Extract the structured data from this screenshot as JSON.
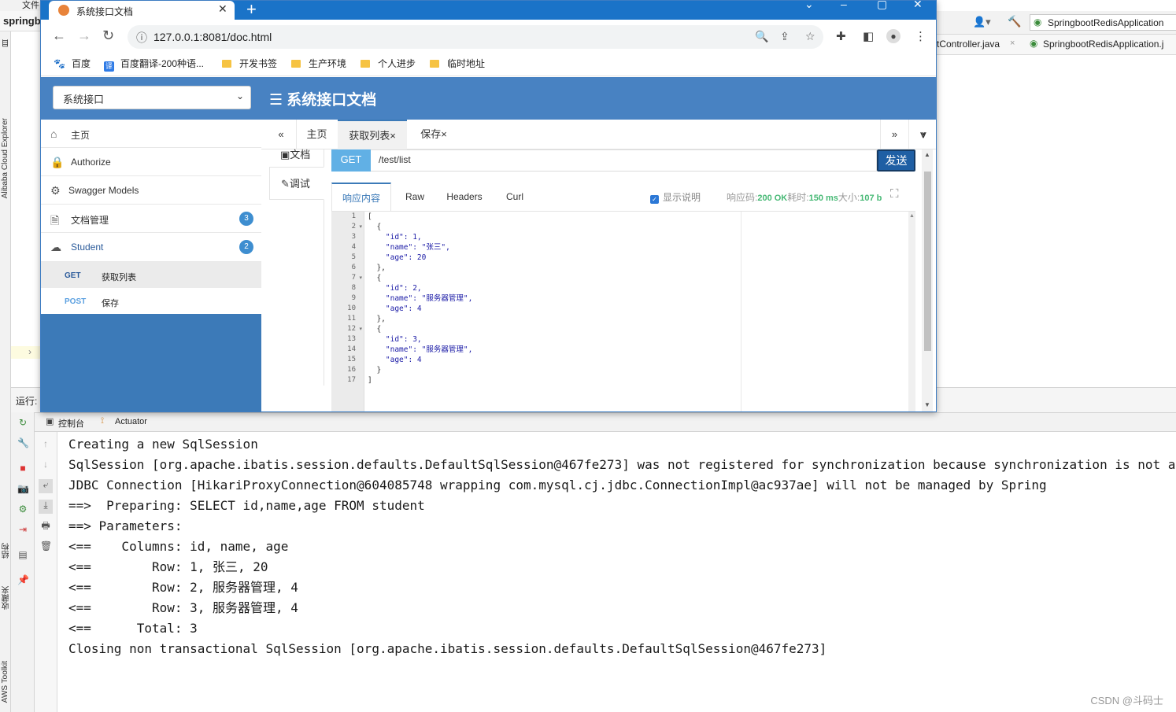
{
  "ide": {
    "left_strip": {
      "files_label": "目",
      "alibaba_label": "Alibaba Cloud Explorer",
      "structure_label": "结构",
      "favorites_label": "收藏夹",
      "aws_label": "AWS Toolkit"
    },
    "top_left_label": "springb",
    "top_left_label2": "文件",
    "right_toolbar": {
      "run_config": "SpringbootRedisApplication"
    },
    "right_tabs": [
      "tController.java",
      "SpringbootRedisApplication.j"
    ],
    "run_label": "运行:",
    "console_tabs": {
      "console": "控制台",
      "actuator": "Actuator"
    },
    "console_lines": [
      "Creating a new SqlSession",
      "SqlSession [org.apache.ibatis.session.defaults.DefaultSqlSession@467fe273] was not registered for synchronization because synchronization is not active",
      "JDBC Connection [HikariProxyConnection@604085748 wrapping com.mysql.cj.jdbc.ConnectionImpl@ac937ae] will not be managed by Spring",
      "==>  Preparing: SELECT id,name,age FROM student",
      "==> Parameters: ",
      "<==    Columns: id, name, age",
      "<==        Row: 1, 张三, 20",
      "<==        Row: 2, 服务器管理, 4",
      "<==        Row: 3, 服务器管理, 4",
      "<==      Total: 3",
      "Closing non transactional SqlSession [org.apache.ibatis.session.defaults.DefaultSqlSession@467fe273]"
    ],
    "watermark": "CSDN @斗码士"
  },
  "browser": {
    "tab_title": "系统接口文档",
    "url": "127.0.0.1:8081/doc.html",
    "bookmarks": [
      {
        "label": "百度",
        "type": "baidu"
      },
      {
        "label": "百度翻译-200种语...",
        "type": "fanyi"
      },
      {
        "label": "开发书签",
        "type": "folder"
      },
      {
        "label": "生产环境",
        "type": "folder"
      },
      {
        "label": "个人进步",
        "type": "folder"
      },
      {
        "label": "临时地址",
        "type": "folder"
      }
    ]
  },
  "swagger": {
    "group_select": "系统接口",
    "title": "☰ 系统接口文档",
    "menu": [
      {
        "label": "主页",
        "icon": "home-icon"
      },
      {
        "label": "Authorize",
        "icon": "lock-icon"
      },
      {
        "label": "Swagger Models",
        "icon": "models-icon"
      },
      {
        "label": "文档管理",
        "icon": "doc-icon",
        "badge": "3"
      },
      {
        "label": "Student",
        "icon": "cloud-icon",
        "badge": "2"
      }
    ],
    "submenu": [
      {
        "method": "GET",
        "label": "获取列表",
        "color": "#2a5a9a"
      },
      {
        "method": "POST",
        "label": "保存",
        "color": "#5ba0e0"
      }
    ],
    "tabs": {
      "prev": "«",
      "home": "主页",
      "list": "获取列表×",
      "save": "保存×",
      "next": "»",
      "more": "⩔"
    },
    "left_tabs": {
      "doc": "▣文档",
      "debug": "✎调试"
    },
    "request": {
      "method": "GET",
      "path": "/test/list",
      "send": "发送"
    },
    "response_tabs": [
      "响应内容",
      "Raw",
      "Headers",
      "Curl"
    ],
    "show_desc": "显示说明",
    "meta": {
      "code_label": "响应码:",
      "code": "200 OK",
      "time_label": "耗时:",
      "time": "150 ms",
      "size_label": "大小:",
      "size": "107 b"
    },
    "line_numbers": [
      "1",
      "2",
      "3",
      "4",
      "5",
      "6",
      "7",
      "8",
      "9",
      "10",
      "11",
      "12",
      "13",
      "14",
      "15",
      "16",
      "17"
    ],
    "code_lines": [
      "[",
      "  {",
      "    \"id\": 1,",
      "    \"name\": \"张三\",",
      "    \"age\": 20",
      "  },",
      "  {",
      "    \"id\": 2,",
      "    \"name\": \"服务器管理\",",
      "    \"age\": 4",
      "  },",
      "  {",
      "    \"id\": 3,",
      "    \"name\": \"服务器管理\",",
      "    \"age\": 4",
      "  }",
      "]"
    ]
  },
  "colors": {
    "header_blue": "#4882c2",
    "sidebar_blue": "#3c7ab8",
    "chrome_blue": "#1a73c8",
    "ok_green": "#47b975",
    "badge_blue": "#3e8ed0"
  }
}
